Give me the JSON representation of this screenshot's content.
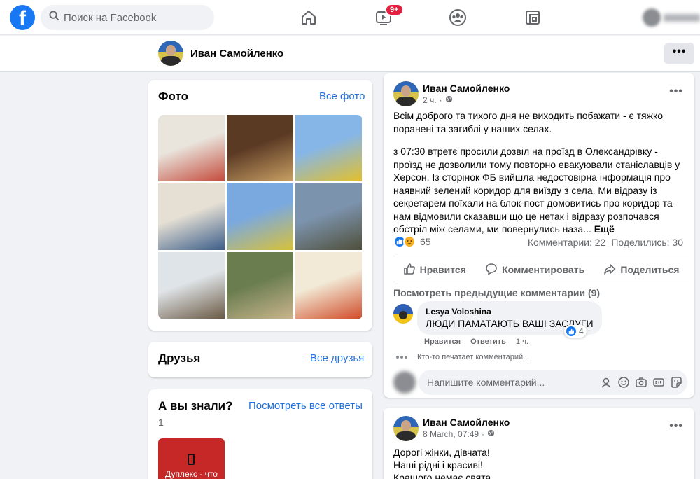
{
  "topbar": {
    "logo": "f",
    "search_placeholder": "Поиск на Facebook",
    "nav": [
      {
        "icon": "home-icon"
      },
      {
        "icon": "watch-icon",
        "badge": "9+"
      },
      {
        "icon": "groups-icon"
      },
      {
        "icon": "gaming-icon"
      }
    ]
  },
  "profile": {
    "name": "Иван Самойленко",
    "more_label": "•••"
  },
  "photos": {
    "title": "Фото",
    "see_all": "Все фото",
    "thumb_colors": [
      [
        "#e9e4dc",
        "#c44a3b"
      ],
      [
        "#5b3a24",
        "#c9a064"
      ],
      [
        "#86b6e8",
        "#e3c02a"
      ],
      [
        "#e6e0d4",
        "#3b5d8a"
      ],
      [
        "#7aa9e0",
        "#d8c13a"
      ],
      [
        "#7c93ad",
        "#4f4f3a"
      ],
      [
        "#dfe4e8",
        "#6b5a44"
      ],
      [
        "#6a7d4f",
        "#c9b48e"
      ],
      [
        "#f2ead6",
        "#d14d2b"
      ]
    ]
  },
  "friends": {
    "title": "Друзья",
    "see_all": "Все друзья"
  },
  "did_you_know": {
    "title": "А вы знали?",
    "see_all": "Посмотреть все ответы",
    "count": "1",
    "tile_label": "Дуплекс - что"
  },
  "post1": {
    "author": "Иван Самойленко",
    "time": "2 ч.",
    "more_label": "•••",
    "paragraph1": "Всім доброго та тихого дня не виходить побажати - є тяжко поранені та загиблі у наших селах.",
    "paragraph2": "з 07:30 втретє просили дозвіл на проїзд в Олександрівку - проїзд не дозволили тому повторно евакуювали станіславців у Херсон. Із сторінок ФБ вийшла недостовірна інформація про наявний зелений коридор для виїзду з села. Ми відразу із секретарем поїхали на блок-пост домовитись про коридор та нам відмовили сказавши що це нетак і відразу розпочався обстріл між селами, ми повернулись наза...",
    "more_text": "Ещё",
    "reactions_count": "65",
    "comments_count": "Комментарии: 22",
    "shares_count": "Поделились: 30",
    "actions": {
      "like": "Нравится",
      "comment": "Комментировать",
      "share": "Поделиться"
    },
    "prev_comments": "Посмотреть предыдущие комментарии (9)",
    "comment": {
      "author": "Lesya Voloshina",
      "text": "ЛЮДИ ПАМАТАЮТЬ ВАШІ ЗАСЛУГИ",
      "likes": "4",
      "like_label": "Нравится",
      "reply_label": "Ответить",
      "time": "1 ч."
    },
    "typing": "Кто-то печатает комментарий...",
    "write_placeholder": "Напишите комментарий..."
  },
  "post2": {
    "author": "Иван Самойленко",
    "time": "8 March, 07:49",
    "more_label": "•••",
    "lines": [
      "Дорогі жінки, дівчата!",
      "Наші рідні і красиві!",
      "Кращого немає свята"
    ]
  }
}
